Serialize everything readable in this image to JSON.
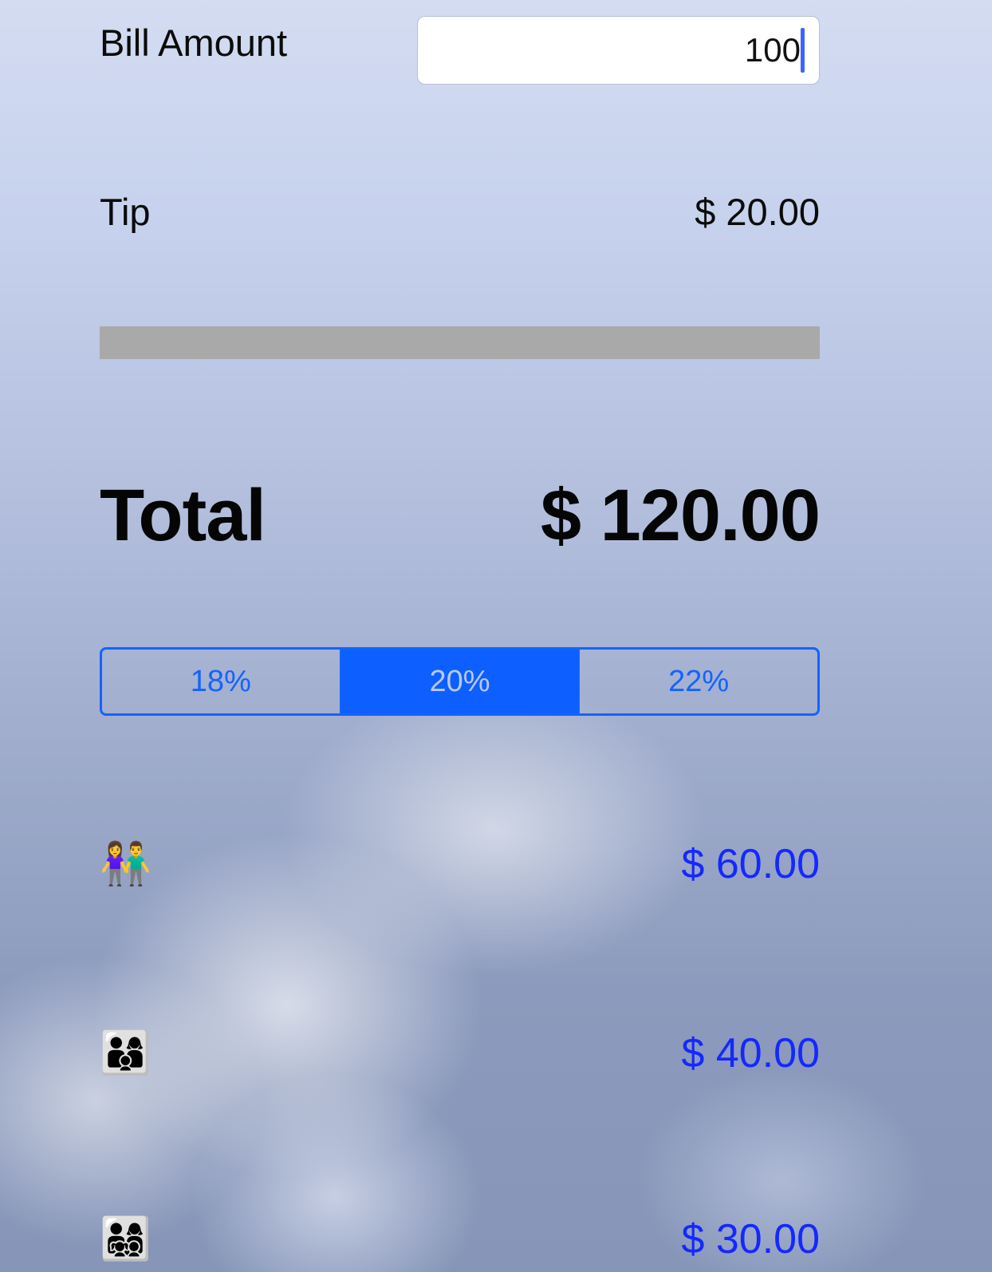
{
  "bill": {
    "label": "Bill Amount",
    "value": "100"
  },
  "tip": {
    "label": "Tip",
    "value": "$ 20.00"
  },
  "total": {
    "label": "Total",
    "value": "$ 120.00"
  },
  "tip_options": {
    "options": [
      "18%",
      "20%",
      "22%"
    ],
    "selected": "20%"
  },
  "splits": [
    {
      "icon": "couple-icon",
      "emoji": "👫",
      "value": "$ 60.00"
    },
    {
      "icon": "family-three-icon",
      "emoji": "👨‍👩‍👦",
      "value": "$ 40.00"
    },
    {
      "icon": "family-four-icon",
      "emoji": "👨‍👩‍👧‍👦",
      "value": "$ 30.00"
    }
  ],
  "colors": {
    "accent": "#1463ff",
    "split_value": "#1428ff",
    "divider": "#a9a9a9"
  }
}
